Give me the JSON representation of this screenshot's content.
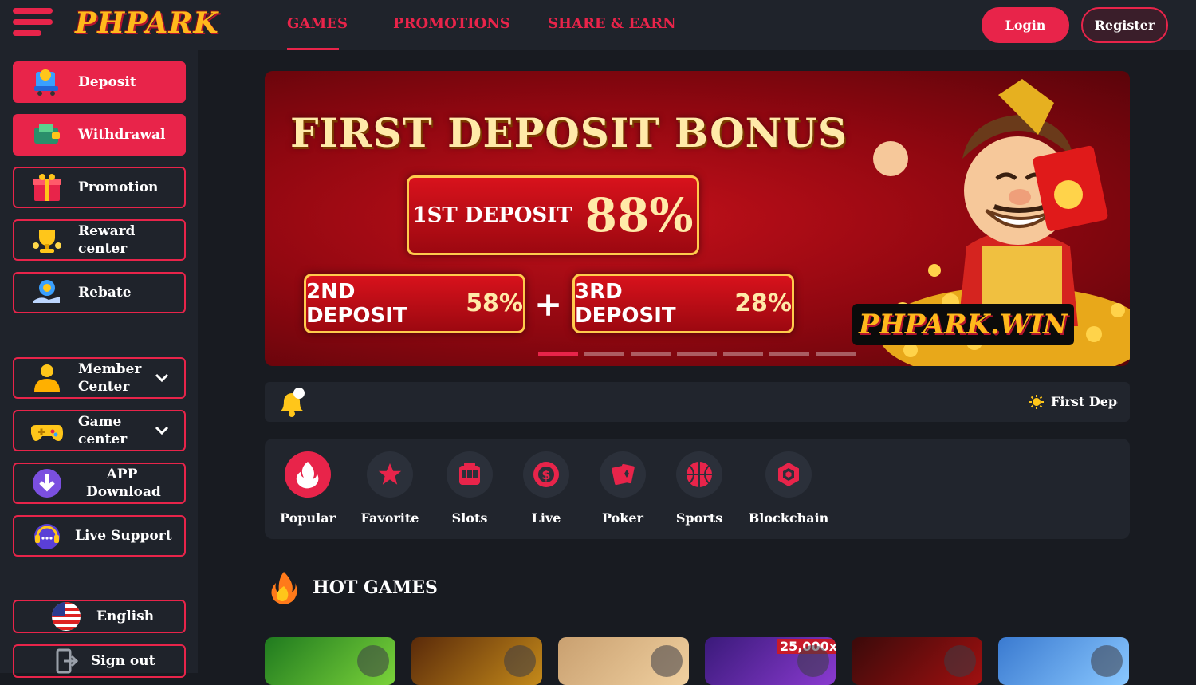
{
  "header": {
    "logo_text": "PHPARK",
    "nav": [
      {
        "label": "GAMES"
      },
      {
        "label": "PROMOTIONS"
      },
      {
        "label": "SHARE & EARN"
      }
    ],
    "login_label": "Login",
    "register_label": "Register"
  },
  "sidebar": {
    "items": [
      {
        "label": "Deposit",
        "icon": "deposit-cart-icon"
      },
      {
        "label": "Withdrawal",
        "icon": "wallet-icon"
      },
      {
        "label": "Promotion",
        "icon": "gift-icon"
      },
      {
        "label": "Reward center",
        "icon": "trophy-icon"
      },
      {
        "label": "Rebate",
        "icon": "rebate-coin-icon"
      },
      {
        "label": "Member Center",
        "icon": "user-icon"
      },
      {
        "label": "Game center",
        "icon": "gamepad-icon"
      },
      {
        "label": "APP Download",
        "icon": "download-icon"
      },
      {
        "label": "Live Support",
        "icon": "headset-icon"
      },
      {
        "label": "English",
        "icon": "us-flag-icon"
      },
      {
        "label": "Sign out",
        "icon": "sign-out-icon"
      }
    ]
  },
  "banner": {
    "title": "FIRST DEPOSIT BONUS",
    "first_label": "1ST DEPOSIT",
    "first_value": "88%",
    "second_label": "2ND DEPOSIT",
    "second_value": "58%",
    "plus": "+",
    "third_label": "3RD DEPOSIT",
    "third_value": "28%",
    "brand": "PHPARK.WIN",
    "slide_count": 7,
    "active_slide": 1
  },
  "notice": {
    "text": "First Deposit"
  },
  "categories": [
    {
      "label": "Popular",
      "icon": "flame-icon"
    },
    {
      "label": "Favorite",
      "icon": "star-icon"
    },
    {
      "label": "Slots",
      "icon": "slot-machine-icon"
    },
    {
      "label": "Live",
      "icon": "casino-chip-icon"
    },
    {
      "label": "Poker",
      "icon": "playing-cards-icon"
    },
    {
      "label": "Sports",
      "icon": "basketball-icon"
    },
    {
      "label": "Blockchain",
      "icon": "blockchain-icon"
    }
  ],
  "hot_games": {
    "title": "HOT GAMES",
    "multiplier_badge": "25,000x"
  },
  "colors": {
    "accent": "#e8244a",
    "background": "#181b21",
    "panel": "#21252d",
    "logo": "#ffb81c"
  }
}
